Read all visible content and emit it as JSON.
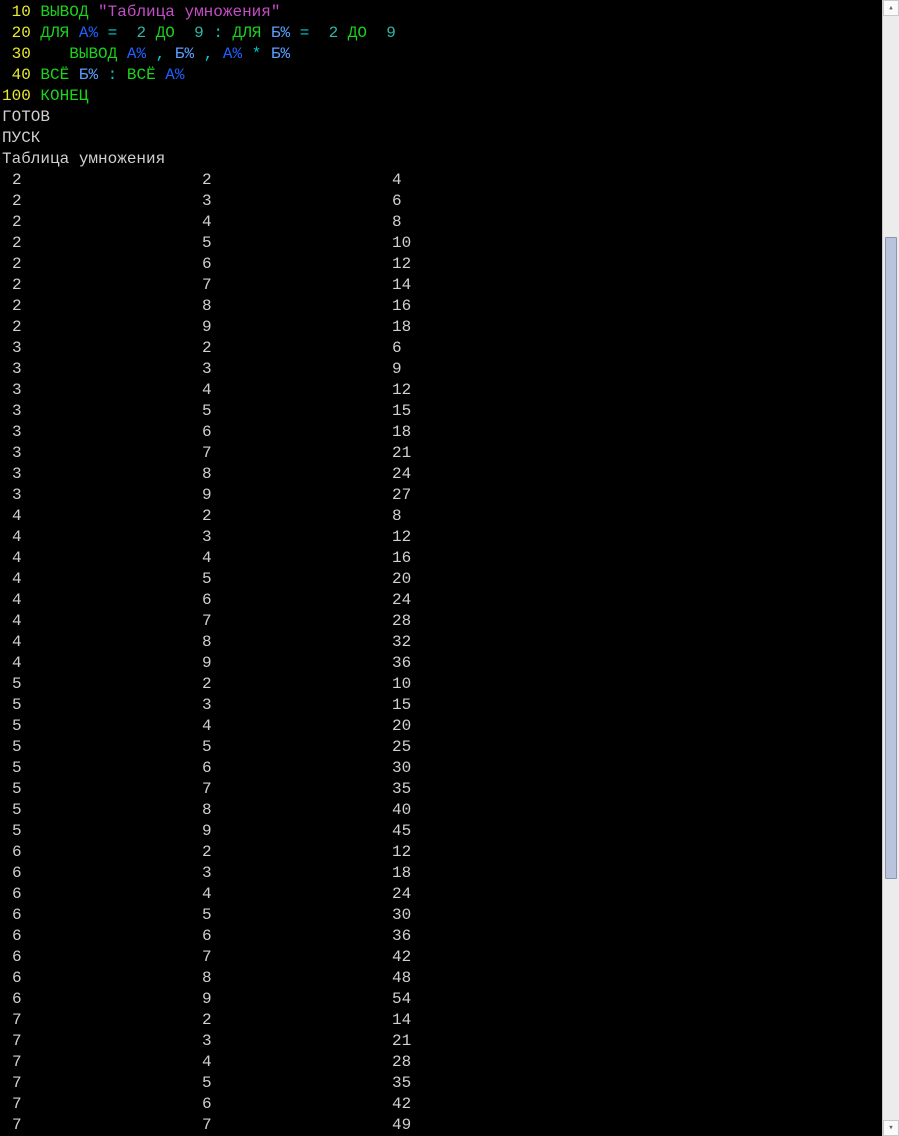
{
  "listing": {
    "lines": [
      {
        "number": "10",
        "tokens": [
          {
            "cls": "kw",
            "t": "ВЫВОД"
          },
          {
            "cls": "",
            "t": " "
          },
          {
            "cls": "str",
            "t": "\"Таблица умножения\""
          }
        ]
      },
      {
        "number": "20",
        "tokens": [
          {
            "cls": "kw",
            "t": "ДЛЯ"
          },
          {
            "cls": "",
            "t": " "
          },
          {
            "cls": "varA",
            "t": "А%"
          },
          {
            "cls": "",
            "t": " "
          },
          {
            "cls": "op",
            "t": "="
          },
          {
            "cls": "",
            "t": "  "
          },
          {
            "cls": "num",
            "t": "2"
          },
          {
            "cls": "",
            "t": " "
          },
          {
            "cls": "kw",
            "t": "ДО"
          },
          {
            "cls": "",
            "t": "  "
          },
          {
            "cls": "num",
            "t": "9"
          },
          {
            "cls": "",
            "t": " "
          },
          {
            "cls": "op",
            "t": ":"
          },
          {
            "cls": "",
            "t": " "
          },
          {
            "cls": "kw",
            "t": "ДЛЯ"
          },
          {
            "cls": "",
            "t": " "
          },
          {
            "cls": "varB",
            "t": "Б%"
          },
          {
            "cls": "",
            "t": " "
          },
          {
            "cls": "op",
            "t": "="
          },
          {
            "cls": "",
            "t": "  "
          },
          {
            "cls": "num",
            "t": "2"
          },
          {
            "cls": "",
            "t": " "
          },
          {
            "cls": "kw",
            "t": "ДО"
          },
          {
            "cls": "",
            "t": "  "
          },
          {
            "cls": "num",
            "t": "9"
          }
        ]
      },
      {
        "number": "30",
        "tokens": [
          {
            "cls": "",
            "t": "   "
          },
          {
            "cls": "kw",
            "t": "ВЫВОД"
          },
          {
            "cls": "",
            "t": " "
          },
          {
            "cls": "varA",
            "t": "А%"
          },
          {
            "cls": "",
            "t": " "
          },
          {
            "cls": "op",
            "t": ","
          },
          {
            "cls": "",
            "t": " "
          },
          {
            "cls": "varB",
            "t": "Б%"
          },
          {
            "cls": "",
            "t": " "
          },
          {
            "cls": "op",
            "t": ","
          },
          {
            "cls": "",
            "t": " "
          },
          {
            "cls": "varA",
            "t": "А%"
          },
          {
            "cls": "",
            "t": " "
          },
          {
            "cls": "op",
            "t": "*"
          },
          {
            "cls": "",
            "t": " "
          },
          {
            "cls": "varB",
            "t": "Б%"
          }
        ]
      },
      {
        "number": "40",
        "tokens": [
          {
            "cls": "kw",
            "t": "ВСЁ"
          },
          {
            "cls": "",
            "t": " "
          },
          {
            "cls": "varB",
            "t": "Б%"
          },
          {
            "cls": "",
            "t": " "
          },
          {
            "cls": "op",
            "t": ":"
          },
          {
            "cls": "",
            "t": " "
          },
          {
            "cls": "kw",
            "t": "ВСЁ"
          },
          {
            "cls": "",
            "t": " "
          },
          {
            "cls": "varA",
            "t": "А%"
          }
        ]
      },
      {
        "number": "100",
        "tokens": [
          {
            "cls": "kw",
            "t": "КОНЕЦ"
          }
        ]
      }
    ]
  },
  "status": {
    "ready": "ГОТОВ",
    "run": "ПУСК",
    "title": "Таблица умножения"
  },
  "output": {
    "rows": [
      [
        2,
        2,
        4
      ],
      [
        2,
        3,
        6
      ],
      [
        2,
        4,
        8
      ],
      [
        2,
        5,
        10
      ],
      [
        2,
        6,
        12
      ],
      [
        2,
        7,
        14
      ],
      [
        2,
        8,
        16
      ],
      [
        2,
        9,
        18
      ],
      [
        3,
        2,
        6
      ],
      [
        3,
        3,
        9
      ],
      [
        3,
        4,
        12
      ],
      [
        3,
        5,
        15
      ],
      [
        3,
        6,
        18
      ],
      [
        3,
        7,
        21
      ],
      [
        3,
        8,
        24
      ],
      [
        3,
        9,
        27
      ],
      [
        4,
        2,
        8
      ],
      [
        4,
        3,
        12
      ],
      [
        4,
        4,
        16
      ],
      [
        4,
        5,
        20
      ],
      [
        4,
        6,
        24
      ],
      [
        4,
        7,
        28
      ],
      [
        4,
        8,
        32
      ],
      [
        4,
        9,
        36
      ],
      [
        5,
        2,
        10
      ],
      [
        5,
        3,
        15
      ],
      [
        5,
        4,
        20
      ],
      [
        5,
        5,
        25
      ],
      [
        5,
        6,
        30
      ],
      [
        5,
        7,
        35
      ],
      [
        5,
        8,
        40
      ],
      [
        5,
        9,
        45
      ],
      [
        6,
        2,
        12
      ],
      [
        6,
        3,
        18
      ],
      [
        6,
        4,
        24
      ],
      [
        6,
        5,
        30
      ],
      [
        6,
        6,
        36
      ],
      [
        6,
        7,
        42
      ],
      [
        6,
        8,
        48
      ],
      [
        6,
        9,
        54
      ],
      [
        7,
        2,
        14
      ],
      [
        7,
        3,
        21
      ],
      [
        7,
        4,
        28
      ],
      [
        7,
        5,
        35
      ],
      [
        7,
        6,
        42
      ],
      [
        7,
        7,
        49
      ]
    ]
  },
  "scrollbar": {
    "up_glyph": "▴",
    "down_glyph": "▾"
  }
}
